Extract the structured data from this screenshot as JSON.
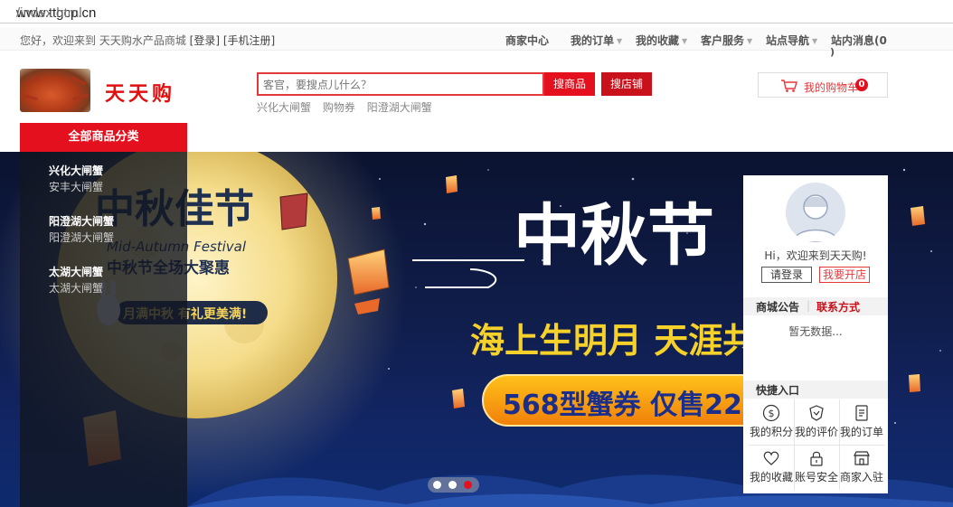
{
  "browser": {
    "url_host": "www.ttgcp.cn",
    "url_path": "/index.html"
  },
  "topbar": {
    "welcome_prefix": "您好，欢迎来到 天天购水产品商城 ",
    "login_link": "[登录]",
    "register_link": "[手机注册]",
    "nav": [
      {
        "label": "商家中心",
        "dropdown": false
      },
      {
        "label": "我的订单",
        "dropdown": true
      },
      {
        "label": "我的收藏",
        "dropdown": true
      },
      {
        "label": "客户服务",
        "dropdown": true
      },
      {
        "label": "站点导航",
        "dropdown": true
      }
    ],
    "messages_label": "站内消息(0",
    "messages_close": ")"
  },
  "header": {
    "logo_text": "天天购",
    "search_placeholder": "客官，要搜点儿什么？",
    "search_goods_label": "搜商品",
    "search_shop_label": "搜店铺",
    "hot_words": [
      "兴化大闸蟹",
      "购物券",
      "阳澄湖大闸蟹"
    ],
    "cart_label": "我的购物车",
    "cart_count": "0",
    "all_categories_label": "全部商品分类"
  },
  "categories": [
    {
      "title": "兴化大闸蟹",
      "sub": "安丰大闸蟹"
    },
    {
      "title": "阳澄湖大闸蟹",
      "sub": "阳澄湖大闸蟹"
    },
    {
      "title": "太湖大闸蟹",
      "sub": "太湖大闸蟹"
    }
  ],
  "banner": {
    "title_cn": "中秋佳节",
    "subtitle_en": "Mid-Autumn Festival",
    "tagline": "中秋节全场大聚惠",
    "pill_text": "月满中秋 有礼更美满!",
    "big_title": "中秋节",
    "poem": "海上生明月 天涯共",
    "coupon_text": "568型蟹券 仅售22",
    "active_slide": 3,
    "slides": 3
  },
  "user_panel": {
    "greeting": "Hi，欢迎来到天天购!",
    "login_button": "请登录",
    "open_shop_button": "我要开店",
    "notice_tab": "商城公告",
    "contact_tab": "联系方式",
    "no_data": "暂无数据...",
    "quick_entry_title": "快捷入口",
    "quick_links": [
      {
        "label": "我的积分",
        "icon": "coin-icon"
      },
      {
        "label": "我的评价",
        "icon": "badge-icon"
      },
      {
        "label": "我的订单",
        "icon": "clipboard-icon"
      },
      {
        "label": "我的收藏",
        "icon": "heart-icon"
      },
      {
        "label": "账号安全",
        "icon": "lock-icon"
      },
      {
        "label": "商家入驻",
        "icon": "store-icon"
      }
    ]
  },
  "colors": {
    "brand_red": "#e4101e",
    "banner_blue": "#101d4a",
    "coupon_orange": "#f39c12"
  }
}
